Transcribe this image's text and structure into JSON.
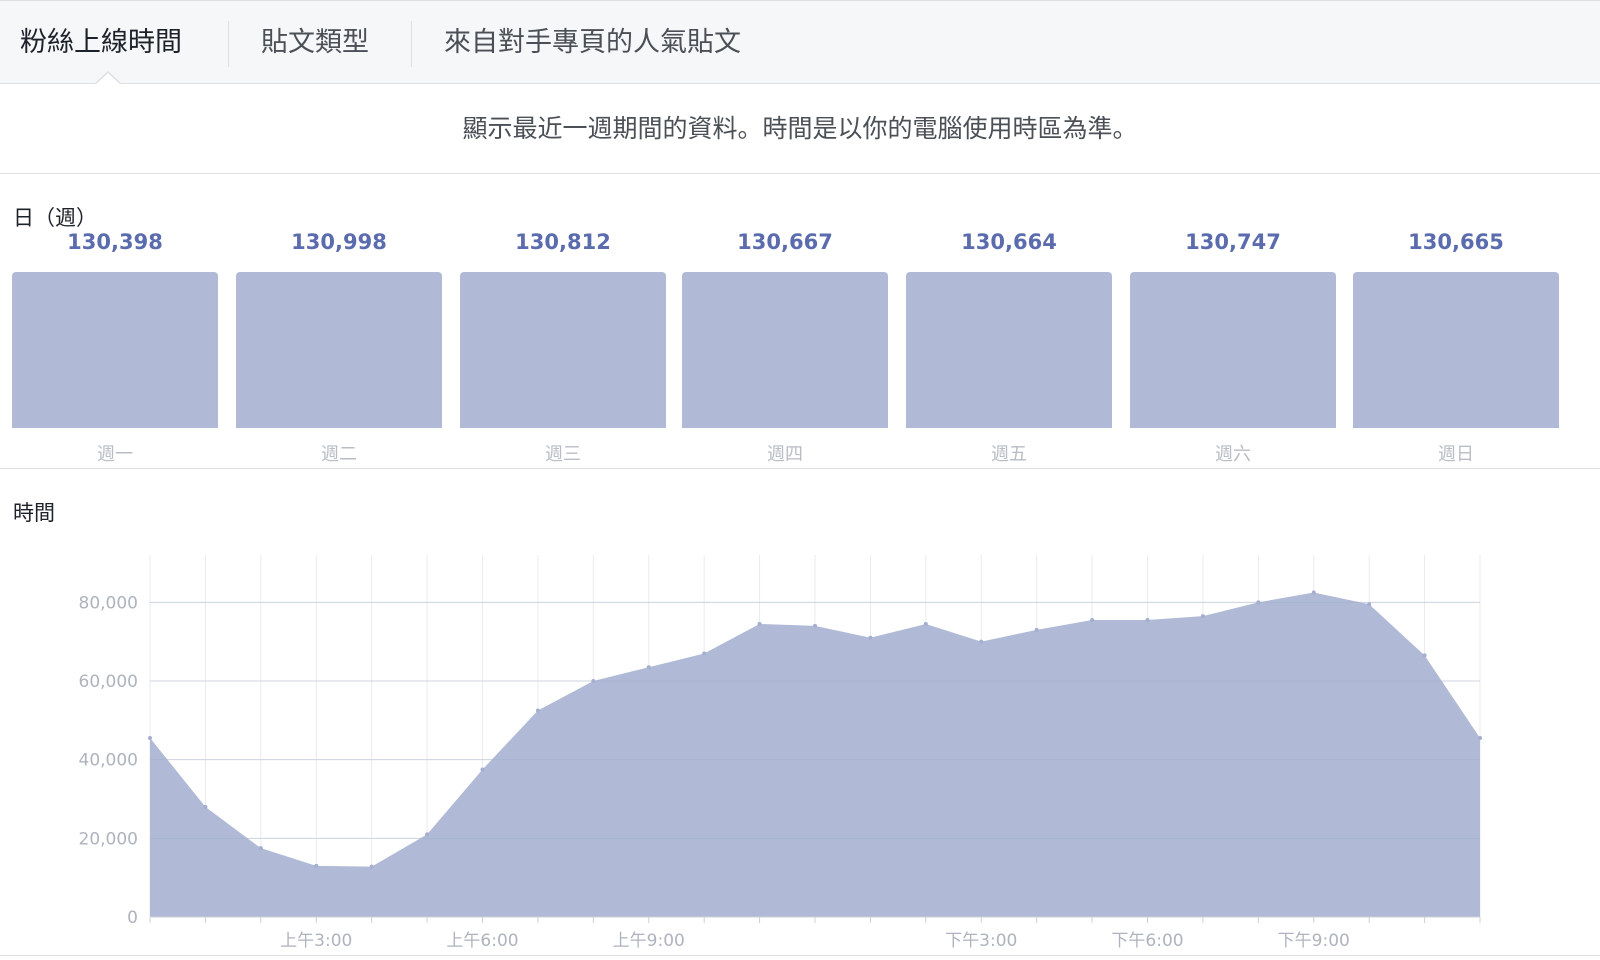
{
  "tabs": [
    {
      "label": "粉絲上線時間",
      "active": true
    },
    {
      "label": "貼文類型",
      "active": false
    },
    {
      "label": "來自對手專頁的人氣貼文",
      "active": false
    }
  ],
  "info_text": "顯示最近一週期間的資料。時間是以你的電腦使用時區為準。",
  "days_section": {
    "title": "日（週）",
    "days": [
      {
        "label": "週一",
        "value": "130,398"
      },
      {
        "label": "週二",
        "value": "130,998"
      },
      {
        "label": "週三",
        "value": "130,812"
      },
      {
        "label": "週四",
        "value": "130,667"
      },
      {
        "label": "週五",
        "value": "130,664"
      },
      {
        "label": "週六",
        "value": "130,747"
      },
      {
        "label": "週日",
        "value": "130,665"
      }
    ]
  },
  "time_section": {
    "title": "時間"
  },
  "colors": {
    "area_fill": "#b0bad6",
    "value_text": "#5b6cae",
    "axis_text": "#aeb3bd",
    "grid": "#e9ebee"
  },
  "chart_data": {
    "type": "area",
    "x": [
      0,
      1,
      2,
      3,
      4,
      5,
      6,
      7,
      8,
      9,
      10,
      11,
      12,
      13,
      14,
      15,
      16,
      17,
      18,
      19,
      20,
      21,
      22,
      23,
      24
    ],
    "values": [
      45500,
      28000,
      17500,
      13000,
      12800,
      21000,
      37500,
      52500,
      60000,
      63500,
      67000,
      74500,
      74000,
      71000,
      74500,
      70000,
      73000,
      75500,
      75500,
      76500,
      80000,
      82500,
      79500,
      66500,
      45500
    ],
    "ylim": [
      0,
      90000
    ],
    "yticks": [
      0,
      20000,
      40000,
      60000,
      80000
    ],
    "ytick_labels": [
      "0",
      "20,000",
      "40,000",
      "60,000",
      "80,000"
    ],
    "xticks": [
      {
        "x": 3,
        "label": "上午3:00"
      },
      {
        "x": 6,
        "label": "上午6:00"
      },
      {
        "x": 9,
        "label": "上午9:00"
      },
      {
        "x": 15,
        "label": "下午3:00"
      },
      {
        "x": 18,
        "label": "下午6:00"
      },
      {
        "x": 21,
        "label": "下午9:00"
      }
    ],
    "grid": true
  }
}
